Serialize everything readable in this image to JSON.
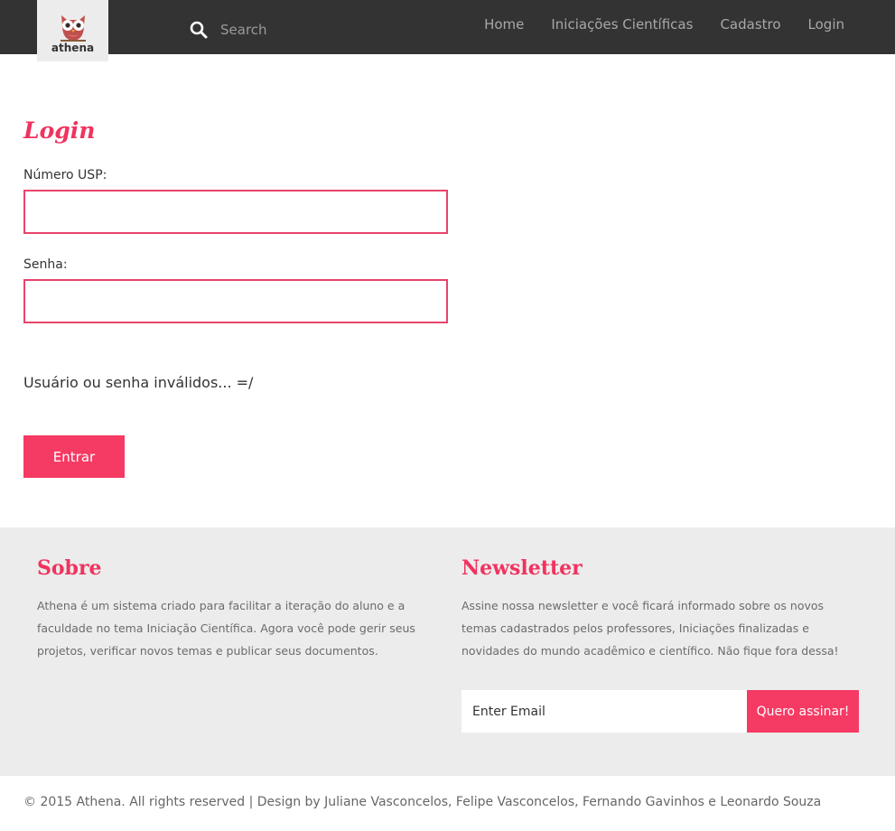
{
  "brand": {
    "logo_text": "athena"
  },
  "search": {
    "placeholder": "Search"
  },
  "nav": {
    "items": [
      "Home",
      "Iniciações Científicas",
      "Cadastro",
      "Login"
    ]
  },
  "login": {
    "title": "Login",
    "usp_label": "Número USP:",
    "usp_value": "",
    "password_label": "Senha:",
    "password_value": "",
    "error_message": "Usuário ou senha inválidos... =/",
    "submit_label": "Entrar"
  },
  "footer": {
    "about": {
      "heading": "Sobre",
      "text": "Athena é um sistema criado para facilitar a iteração do aluno e a faculdade no tema Iniciação Científica. Agora você pode gerir seus projetos, verificar novos temas e publicar seus documentos."
    },
    "newsletter": {
      "heading": "Newsletter",
      "text": "Assine nossa newsletter e você ficará informado sobre os novos temas cadastrados pelos professores, Iniciações finalizadas e novidades do mundo acadêmico e científico. Não fique fora dessa!",
      "email_placeholder": "Enter Email",
      "subscribe_label": "Quero assinar!"
    },
    "copyright": "© 2015 Athena. All rights reserved | Design by Juliane Vasconcelos, Felipe Vasconcelos, Fernando Gavinhos e Leonardo Souza"
  },
  "colors": {
    "accent": "#f53a63",
    "header_bg": "#333333",
    "footer_bg": "#ececec"
  },
  "icons": {
    "logo": "owl-icon",
    "search": "search-icon"
  }
}
